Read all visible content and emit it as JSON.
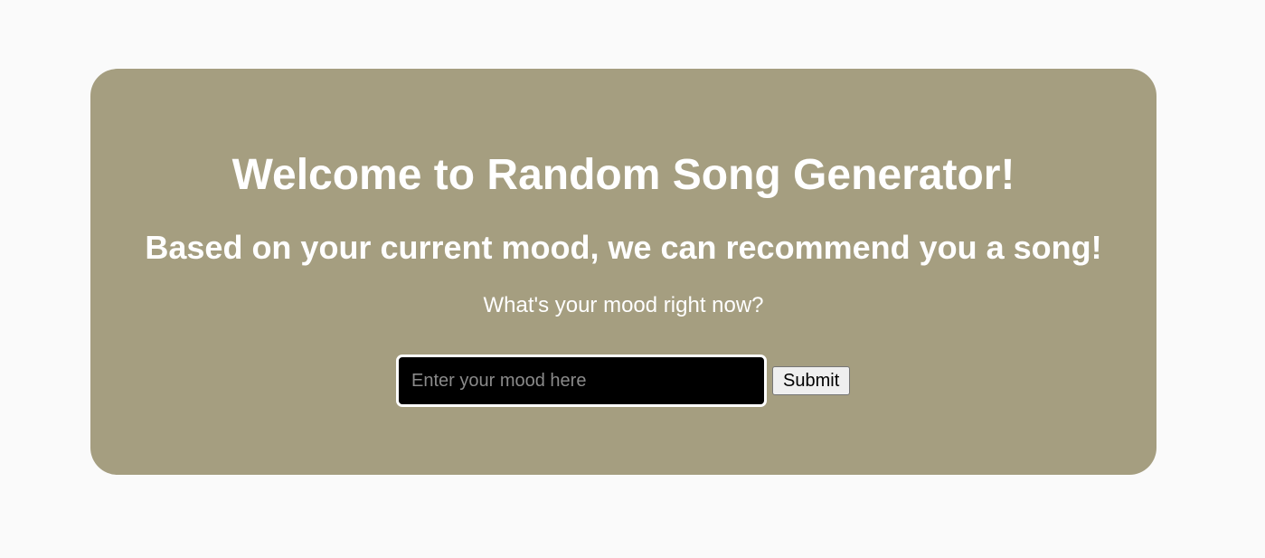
{
  "card": {
    "title": "Welcome to Random Song Generator!",
    "subtitle": "Based on your current mood, we can recommend you a song!",
    "prompt": "What's your mood right now?"
  },
  "form": {
    "mood_input": {
      "value": "",
      "placeholder": "Enter your mood here"
    },
    "submit_label": "Submit"
  },
  "colors": {
    "page_background": "#fafafa",
    "card_background": "#a59e80",
    "text": "#ffffff",
    "input_background": "#000000",
    "input_border": "#ffffff"
  }
}
